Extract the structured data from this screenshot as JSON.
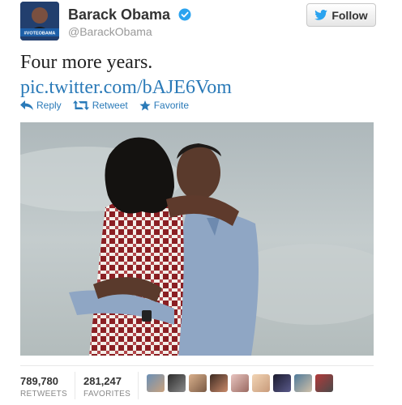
{
  "user": {
    "display_name": "Barack Obama",
    "handle": "@BarackObama",
    "avatar_caption": "#VOTEOBAMA",
    "verified_icon": "verified-badge-icon"
  },
  "follow_button": {
    "label": "Follow",
    "icon": "twitter-bird-icon"
  },
  "tweet": {
    "text": "Four more years.",
    "link": "pic.twitter.com/bAJE6Vom"
  },
  "actions": [
    {
      "label": "Reply",
      "icon": "reply-arrow-icon"
    },
    {
      "label": "Retweet",
      "icon": "retweet-icon"
    },
    {
      "label": "Favorite",
      "icon": "star-icon"
    }
  ],
  "stats": {
    "retweets": {
      "count": "789,780",
      "label": "RETWEETS"
    },
    "favorites": {
      "count": "281,247",
      "label": "FAVORITES"
    }
  },
  "colors": {
    "link": "#2a7ab8",
    "verified": "#2aa3ef",
    "photo_sky": "#b9c3c6"
  },
  "favoriter_avatars": [
    "avatar-1",
    "avatar-2",
    "avatar-3",
    "avatar-4",
    "avatar-5",
    "avatar-6",
    "avatar-7",
    "avatar-8",
    "avatar-9"
  ]
}
